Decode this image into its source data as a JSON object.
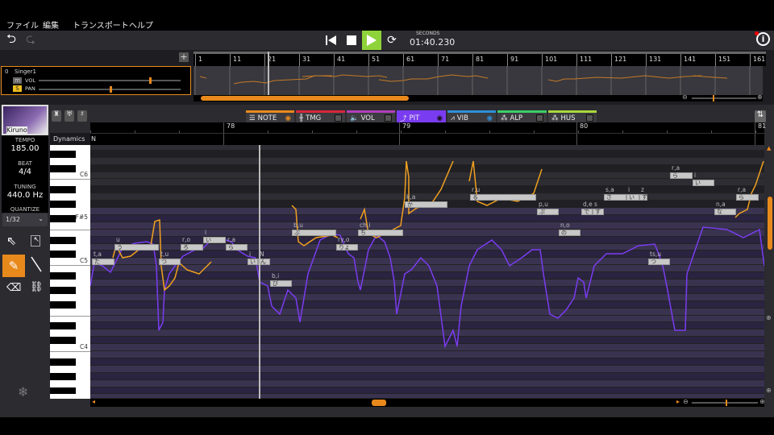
{
  "menu": [
    "ファイル",
    "編集",
    "トランスポート",
    "ヘルプ"
  ],
  "transport": {
    "time_label": "SECONDS",
    "time": "01:40.230"
  },
  "track": {
    "index": "0",
    "name": "Singer1",
    "vol_label": "VOL",
    "pan_label": "PAN",
    "mute": "m",
    "solo": "S",
    "vol": 0.78,
    "pan": 0.5
  },
  "overview_bars": [
    "1",
    "11",
    "21",
    "31",
    "41",
    "51",
    "61",
    "71",
    "81",
    "91",
    "101",
    "111",
    "121",
    "131",
    "141",
    "151",
    "161"
  ],
  "singer": {
    "name": "Kiruno"
  },
  "side": {
    "tempo_label": "TEMPO",
    "tempo": "185.00",
    "beat_label": "BEAT",
    "beat": "4/4",
    "tuning_label": "TUNING",
    "tuning": "440.0 Hz",
    "quantize_label": "QUANTIZE",
    "quantize": "1/32"
  },
  "tabs": [
    {
      "label": "NOTE",
      "color": "#e8891c"
    },
    {
      "label": "TMG",
      "color": "#d9263a"
    },
    {
      "label": "VOL",
      "color": "#b23fb8"
    },
    {
      "label": "PIT",
      "color": "#7a3cf0"
    },
    {
      "label": "VIB",
      "color": "#2f8fd8"
    },
    {
      "label": "ALP",
      "color": "#3ccf6a"
    },
    {
      "label": "HUS",
      "color": "#a8d83c"
    }
  ],
  "ruler": {
    "bars": [
      "78",
      "79",
      "80",
      "81"
    ],
    "dynamics_label": "Dynamics",
    "dynamics_value": "N"
  },
  "keys": {
    "c6": "C6",
    "fs5": "F#5",
    "c5": "C5",
    "c4": "C4"
  },
  "notes": [
    {
      "ph": "t,a",
      "ly": "た",
      "pitch": 72
    },
    {
      "ph": "u",
      "ly": "う",
      "pitch": 74
    },
    {
      "ph": "t,u",
      "ly": "つ",
      "pitch": 72
    },
    {
      "ph": "r,o",
      "ly": "ろ",
      "pitch": 74
    },
    {
      "ph": "i",
      "ly": "い",
      "pitch": 75
    },
    {
      "ph": "r,a",
      "ly": "ら",
      "pitch": 74
    },
    {
      "ph": "i",
      "ly": "い",
      "pitch": 72
    },
    {
      "ph": "N",
      "ly": "ん",
      "pitch": 72
    },
    {
      "ph": "b,i",
      "ly": "び",
      "pitch": 69
    },
    {
      "ph": "b,u",
      "ly": "ぶ",
      "pitch": 76
    },
    {
      "ph": "ry,o",
      "ly": "りょ",
      "pitch": 74
    },
    {
      "ph": "ch,i",
      "ly": "ち",
      "pitch": 76
    },
    {
      "ph": "k,a",
      "ly": "か",
      "pitch": 80
    },
    {
      "ph": "r,u",
      "ly": "る",
      "pitch": 81
    },
    {
      "ph": "p,u",
      "ly": "ぷ",
      "pitch": 79
    },
    {
      "ph": "n,o",
      "ly": "の",
      "pitch": 76
    },
    {
      "ph": "d,e",
      "ly": "で",
      "pitch": 79
    },
    {
      "ph": "s",
      "ly": "す",
      "pitch": 79
    },
    {
      "ph": "s,a",
      "ly": "さ",
      "pitch": 81
    },
    {
      "ph": "i",
      "ly": "い",
      "pitch": 81
    },
    {
      "ph": "z",
      "ly": "ず",
      "pitch": 81
    },
    {
      "ph": "ts,u",
      "ly": "つ",
      "pitch": 72
    },
    {
      "ph": "r,a",
      "ly": "ら",
      "pitch": 84
    },
    {
      "ph": "i",
      "ly": "い",
      "pitch": 83
    },
    {
      "ph": "n,a",
      "ly": "な",
      "pitch": 79
    },
    {
      "ph": "r,a",
      "ly": "ら",
      "pitch": 81
    }
  ]
}
